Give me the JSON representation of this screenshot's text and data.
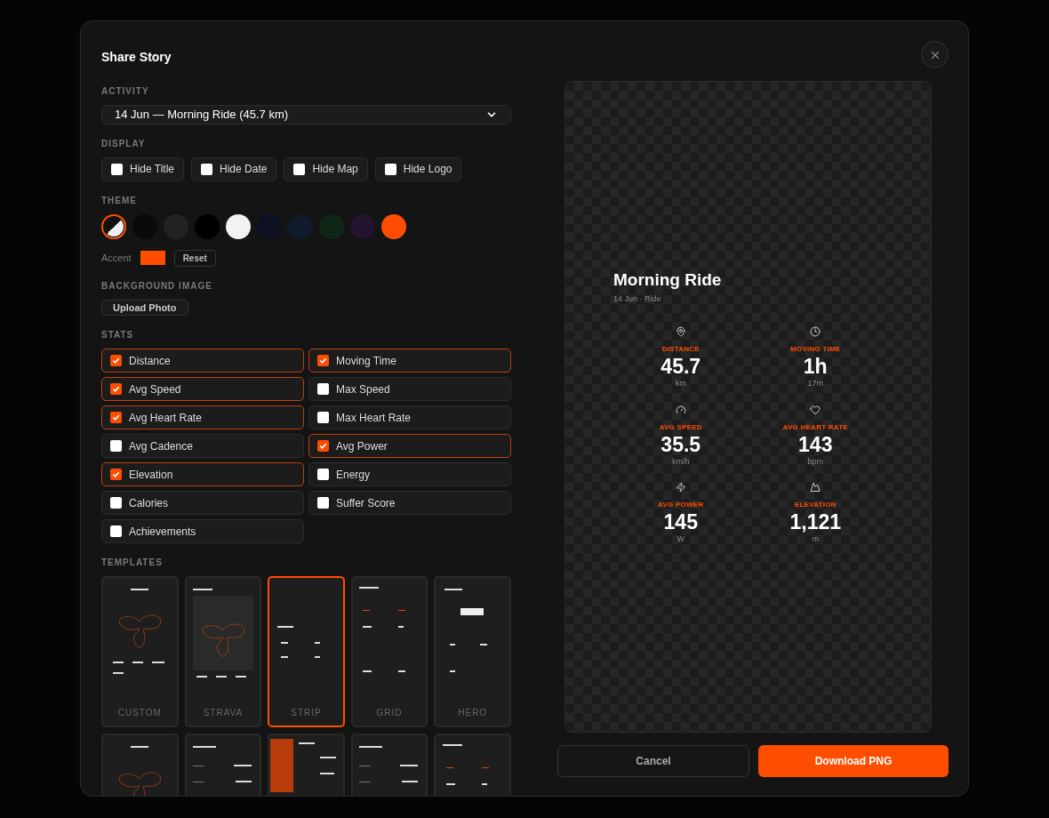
{
  "dialog": {
    "title": "Share Story"
  },
  "activity": {
    "label": "ACTIVITY",
    "value": "14 Jun — Morning Ride (45.7 km)"
  },
  "display": {
    "label": "DISPLAY",
    "options": [
      {
        "label": "Hide Title",
        "checked": false
      },
      {
        "label": "Hide Date",
        "checked": false
      },
      {
        "label": "Hide Map",
        "checked": false
      },
      {
        "label": "Hide Logo",
        "checked": false
      }
    ]
  },
  "theme": {
    "label": "THEME",
    "swatches": [
      {
        "kind": "split",
        "color": "#f0f0f0",
        "selected": true
      },
      {
        "kind": "solid",
        "color": "#0a0a0a",
        "selected": false
      },
      {
        "kind": "solid",
        "color": "#222222",
        "selected": false
      },
      {
        "kind": "solid",
        "color": "#000000",
        "selected": false
      },
      {
        "kind": "solid",
        "color": "#f2f2f2",
        "selected": false
      },
      {
        "kind": "solid",
        "color": "#0d1020",
        "selected": false
      },
      {
        "kind": "solid",
        "color": "#111a2a",
        "selected": false
      },
      {
        "kind": "solid",
        "color": "#0f2616",
        "selected": false
      },
      {
        "kind": "solid",
        "color": "#22142e",
        "selected": false
      },
      {
        "kind": "solid",
        "color": "#ff4d00",
        "selected": false
      }
    ],
    "accent": {
      "label": "Accent",
      "color": "#ff4d00"
    },
    "reset": "Reset"
  },
  "background_image": {
    "label": "BACKGROUND IMAGE",
    "button": "Upload Photo"
  },
  "stats": {
    "label": "STATS",
    "items": [
      {
        "label": "Distance",
        "checked": true
      },
      {
        "label": "Moving Time",
        "checked": true
      },
      {
        "label": "Avg Speed",
        "checked": true
      },
      {
        "label": "Max Speed",
        "checked": false
      },
      {
        "label": "Avg Heart Rate",
        "checked": true
      },
      {
        "label": "Max Heart Rate",
        "checked": false
      },
      {
        "label": "Avg Cadence",
        "checked": false
      },
      {
        "label": "Avg Power",
        "checked": true
      },
      {
        "label": "Elevation",
        "checked": true
      },
      {
        "label": "Energy",
        "checked": false
      },
      {
        "label": "Calories",
        "checked": false
      },
      {
        "label": "Suffer Score",
        "checked": false
      },
      {
        "label": "Achievements",
        "checked": false
      }
    ]
  },
  "templates": {
    "label": "TEMPLATES",
    "items": [
      {
        "label": "CUSTOM",
        "kind": "map",
        "selected": false
      },
      {
        "label": "STRAVA",
        "kind": "framed",
        "selected": false
      },
      {
        "label": "STRIP",
        "kind": "strip",
        "selected": true
      },
      {
        "label": "GRID",
        "kind": "grid",
        "selected": false
      },
      {
        "label": "HERO",
        "kind": "hero",
        "selected": false
      },
      {
        "kind": "map",
        "selected": false
      },
      {
        "kind": "list",
        "selected": false
      },
      {
        "kind": "band",
        "selected": false
      },
      {
        "kind": "list",
        "selected": false
      },
      {
        "kind": "grid",
        "selected": false
      }
    ]
  },
  "preview": {
    "title": "Morning Ride",
    "subtitle": "14 Jun · Ride",
    "stats": [
      {
        "kind": "distance",
        "label": "DISTANCE",
        "value": "45.7",
        "unit": "km"
      },
      {
        "kind": "time",
        "label": "MOVING TIME",
        "value": "1h",
        "unit": "17m"
      },
      {
        "kind": "speed",
        "label": "AVG SPEED",
        "value": "35.5",
        "unit": "km/h"
      },
      {
        "kind": "heart",
        "label": "AVG HEART RATE",
        "value": "143",
        "unit": "bpm"
      },
      {
        "kind": "power",
        "label": "AVG POWER",
        "value": "145",
        "unit": "W"
      },
      {
        "kind": "elevation",
        "label": "ELEVATION",
        "value": "1,121",
        "unit": "m"
      }
    ]
  },
  "buttons": {
    "cancel": "Cancel",
    "download": "Download PNG"
  }
}
